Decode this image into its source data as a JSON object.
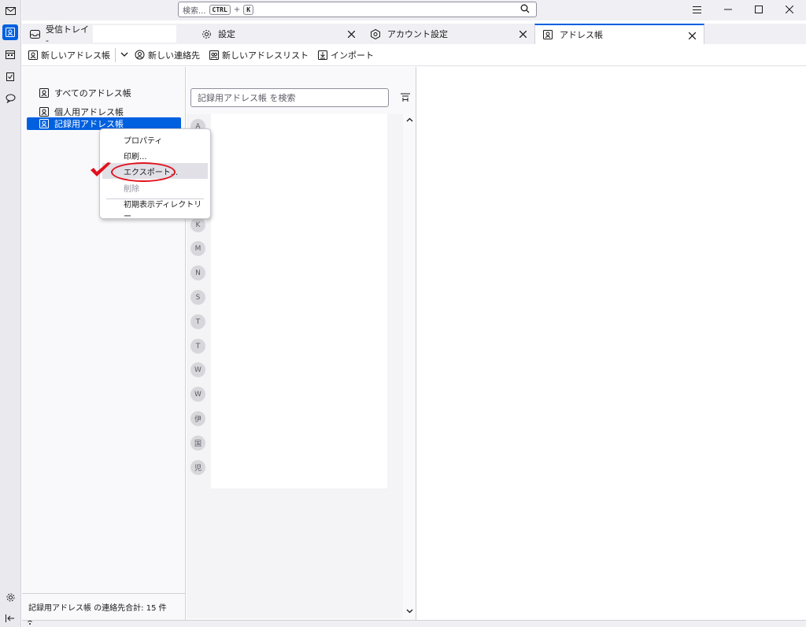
{
  "titlebar": {
    "search_label": "検索...",
    "shortcut_ctrl": "CTRL",
    "shortcut_plus": "+",
    "shortcut_key": "K"
  },
  "spaces": [
    "mail-icon",
    "address-book-icon",
    "calendar-icon",
    "tasks-icon",
    "chat-icon",
    "settings-icon",
    "collapse-icon"
  ],
  "tabs": [
    {
      "label": "受信トレイ -",
      "icon": "inbox-icon"
    },
    {
      "label": "設定",
      "icon": "gear-icon"
    },
    {
      "label": "アカウント設定",
      "icon": "account-icon"
    },
    {
      "label": "アドレス帳",
      "icon": "address-book-icon"
    }
  ],
  "toolbar": {
    "new_address_book": "新しいアドレス帳",
    "new_contact": "新しい連絡先",
    "new_list": "新しいアドレスリスト",
    "import": "インポート"
  },
  "books": {
    "items": [
      "すべてのアドレス帳",
      "個人用アドレス帳",
      "記録用アドレス帳"
    ],
    "selected": "記録用アドレス帳",
    "footer": "記録用アドレス帳 の連絡先合計: 15 件"
  },
  "contacts": {
    "search_placeholder": "記録用アドレス帳 を検索",
    "letters": [
      "A",
      "K",
      "M",
      "N",
      "S",
      "T",
      "T",
      "W",
      "W",
      "伊",
      "国",
      "児"
    ]
  },
  "context_menu": {
    "properties": "プロパティ",
    "print": "印刷...",
    "export": "エクスポート...",
    "delete": "削除",
    "startup_dir": "初期表示ディレクトリー"
  },
  "colors": {
    "accent": "#0060df",
    "annotation": "#e0131e"
  }
}
